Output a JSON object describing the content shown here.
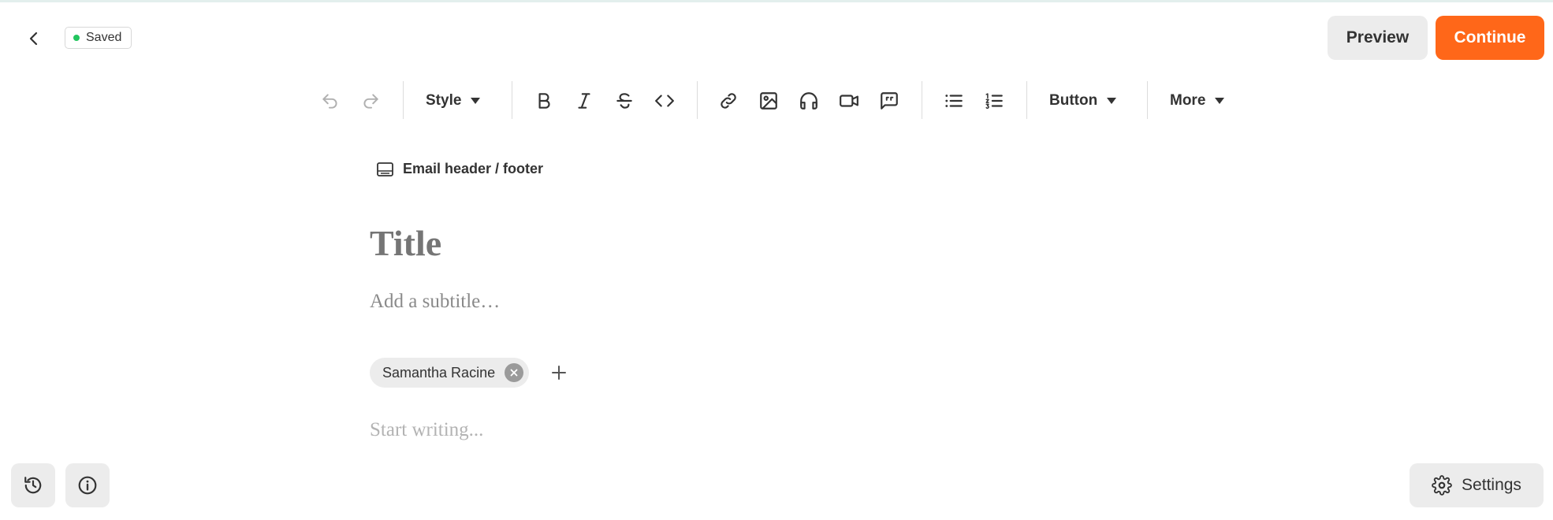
{
  "header": {
    "back_icon": "chevron-left-icon",
    "saved_status": "Saved",
    "saved_color": "#22c55e",
    "preview_label": "Preview",
    "continue_label": "Continue",
    "continue_color": "#ff6719"
  },
  "toolbar": {
    "undo_icon": "undo-icon",
    "redo_icon": "redo-icon",
    "style_label": "Style",
    "button_label": "Button",
    "more_label": "More",
    "format_icons": [
      "bold-icon",
      "italic-icon",
      "strikethrough-icon",
      "code-icon"
    ],
    "insert_icons": [
      "link-icon",
      "image-icon",
      "audio-icon",
      "video-icon",
      "quote-icon"
    ],
    "list_icons": [
      "bulleted-list-icon",
      "numbered-list-icon"
    ]
  },
  "editor": {
    "header_footer_label": "Email header / footer",
    "title_placeholder": "Title",
    "subtitle_placeholder": "Add a subtitle…",
    "author_name": "Samantha Racine",
    "body_placeholder": "Start writing..."
  },
  "footer": {
    "history_icon": "history-icon",
    "info_icon": "info-icon",
    "settings_label": "Settings"
  }
}
